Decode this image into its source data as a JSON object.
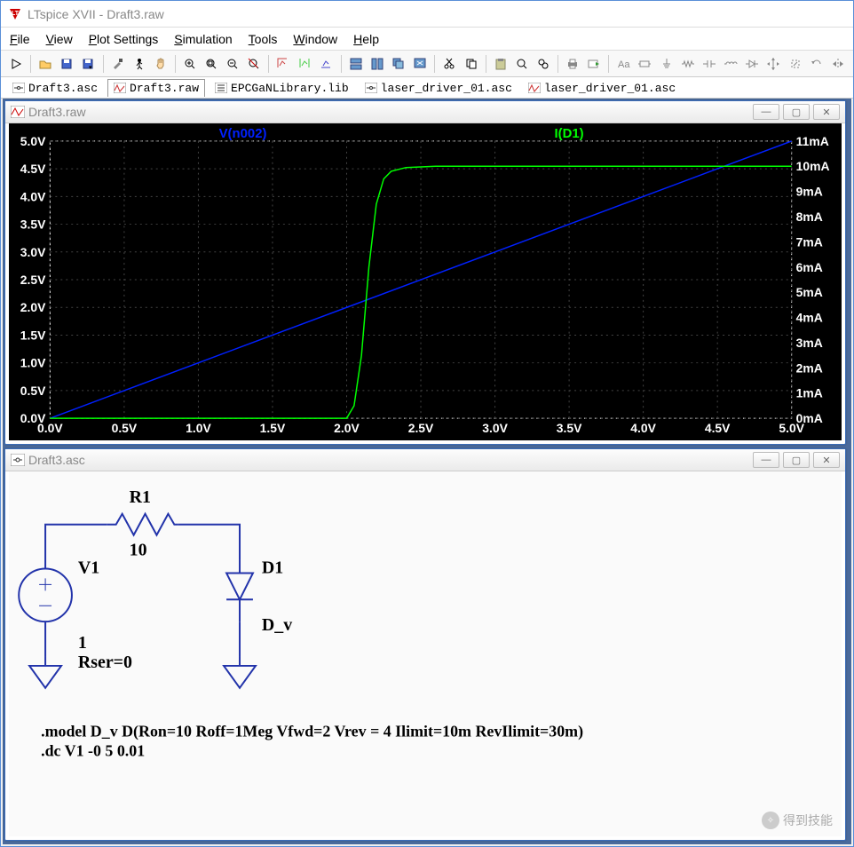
{
  "title": "LTspice XVII - Draft3.raw",
  "menus": [
    "File",
    "View",
    "Plot Settings",
    "Simulation",
    "Tools",
    "Window",
    "Help"
  ],
  "toolbar_icons": [
    "run",
    "open",
    "save",
    "save-options",
    "tool-hammer",
    "runner",
    "hand",
    "zoom-in",
    "zoom-fit",
    "zoom-out",
    "zoom-area",
    "axis1",
    "axis2",
    "axis3",
    "tile-h",
    "tile-v",
    "cascade",
    "window-close",
    "cut",
    "copy",
    "paste",
    "find",
    "find-next",
    "print",
    "export",
    "label",
    "component",
    "ground",
    "resistor",
    "capacitor",
    "inductor",
    "diode",
    "move",
    "drag",
    "rotate",
    "mirror"
  ],
  "tabs": [
    {
      "icon": "asc",
      "label": "Draft3.asc",
      "active": false
    },
    {
      "icon": "raw",
      "label": "Draft3.raw",
      "active": true
    },
    {
      "icon": "lib",
      "label": "EPCGaNLibrary.lib",
      "active": false
    },
    {
      "icon": "asc",
      "label": "laser_driver_01.asc",
      "active": false
    },
    {
      "icon": "raw",
      "label": "laser_driver_01.asc",
      "active": false
    }
  ],
  "plot_window": {
    "title": "Draft3.raw"
  },
  "schem_window": {
    "title": "Draft3.asc"
  },
  "schematic": {
    "V1_name": "V1",
    "V1_val": "1",
    "V1_rser": "Rser=0",
    "R1_name": "R1",
    "R1_val": "10",
    "D1_name": "D1",
    "D1_model": "D_v",
    "spice1": ".model D_v D(Ron=10 Roff=1Meg Vfwd=2 Vrev = 4 Ilimit=10m RevIlimit=30m)",
    "spice2": ".dc V1 -0 5 0.01"
  },
  "watermark": "得到技能",
  "chart_data": {
    "type": "line",
    "title": "",
    "xlabel": "",
    "ylabel_left": "V",
    "ylabel_right": "I",
    "xlim": [
      0.0,
      5.0
    ],
    "xticks": [
      "0.0V",
      "0.5V",
      "1.0V",
      "1.5V",
      "2.0V",
      "2.5V",
      "3.0V",
      "3.5V",
      "4.0V",
      "4.5V",
      "5.0V"
    ],
    "ylim_left": [
      0.0,
      5.0
    ],
    "yticks_left": [
      "0.0V",
      "0.5V",
      "1.0V",
      "1.5V",
      "2.0V",
      "2.5V",
      "3.0V",
      "3.5V",
      "4.0V",
      "4.5V",
      "5.0V"
    ],
    "ylim_right": [
      0,
      11
    ],
    "yticks_right": [
      "0mA",
      "1mA",
      "2mA",
      "3mA",
      "4mA",
      "5mA",
      "6mA",
      "7mA",
      "8mA",
      "9mA",
      "10mA",
      "11mA"
    ],
    "series": [
      {
        "name": "V(n002)",
        "color": "#0020ff",
        "axis": "left",
        "x": [
          0.0,
          0.5,
          1.0,
          1.5,
          2.0,
          2.5,
          3.0,
          3.5,
          4.0,
          4.5,
          5.0
        ],
        "y": [
          0.0,
          0.5,
          1.0,
          1.5,
          2.0,
          2.5,
          3.0,
          3.5,
          4.0,
          4.5,
          5.0
        ]
      },
      {
        "name": "I(D1)",
        "color": "#00ff00",
        "axis": "right",
        "x": [
          0.0,
          1.0,
          1.8,
          2.0,
          2.05,
          2.1,
          2.15,
          2.2,
          2.25,
          2.3,
          2.4,
          2.6,
          3.0,
          4.0,
          5.0
        ],
        "y": [
          0.0,
          0.0,
          0.0,
          0.0,
          0.5,
          2.5,
          6.0,
          8.5,
          9.5,
          9.8,
          9.95,
          10.0,
          10.0,
          10.0,
          10.0
        ]
      }
    ]
  }
}
